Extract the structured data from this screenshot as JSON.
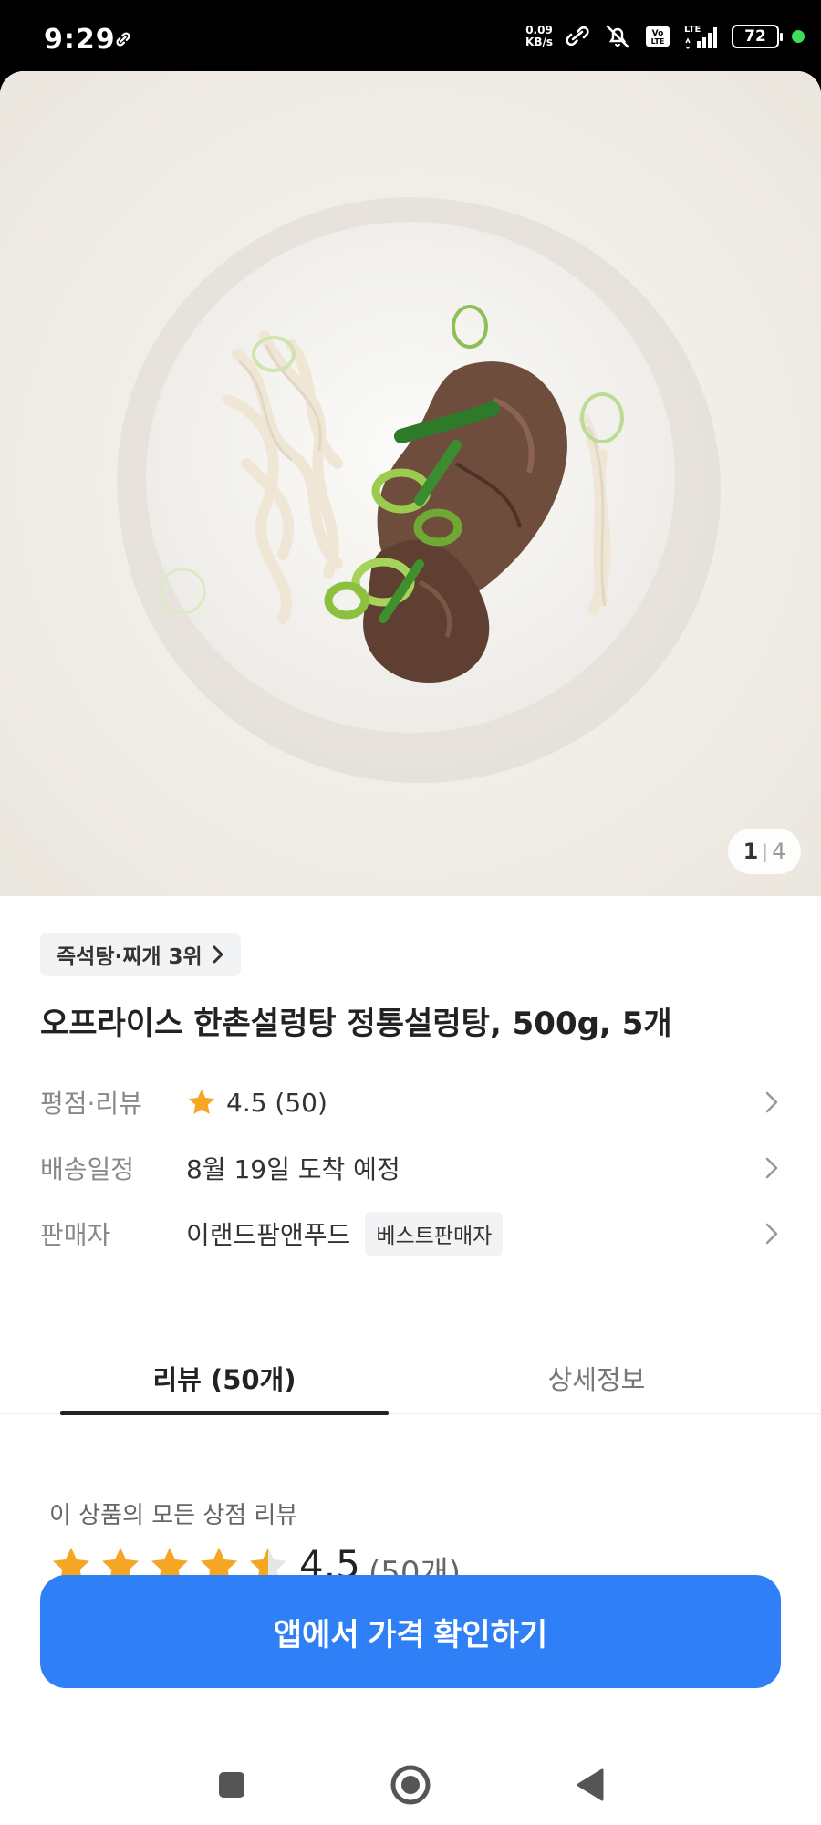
{
  "status_bar": {
    "time": "9:29",
    "net_speed_value": "0.09",
    "net_speed_unit": "KB/s",
    "volte": "Vo LTE",
    "lte": "LTE",
    "battery": "72"
  },
  "product_image": {
    "page_current": "1",
    "page_total": "4"
  },
  "category_rank": {
    "label": "즉석탕·찌개 3위"
  },
  "product": {
    "title": "오프라이스 한촌설렁탕 정통설렁탕, 500g, 5개"
  },
  "info": {
    "rating": {
      "label": "평점·리뷰",
      "value": "4.5 (50)"
    },
    "delivery": {
      "label": "배송일정",
      "value": "8월 19일 도착 예정"
    },
    "seller": {
      "label": "판매자",
      "value": "이랜드팜앤푸드",
      "badge": "베스트판매자"
    }
  },
  "tabs": [
    {
      "label": "리뷰 (50개)",
      "active": true
    },
    {
      "label": "상세정보",
      "active": false
    }
  ],
  "review_summary": {
    "caption": "이 상품의 모든 상점 리뷰",
    "rating": "4.5",
    "count": "(50개)",
    "stars_value": 4.5,
    "stars_max": 5
  },
  "cta": {
    "label": "앱에서 가격 확인하기"
  },
  "colors": {
    "accent": "#2f80f6",
    "star": "#f5a623",
    "star_empty": "#e6e6e6"
  },
  "navbar": {
    "icons": [
      "square-icon",
      "home-circle-icon",
      "back-triangle-icon"
    ]
  }
}
